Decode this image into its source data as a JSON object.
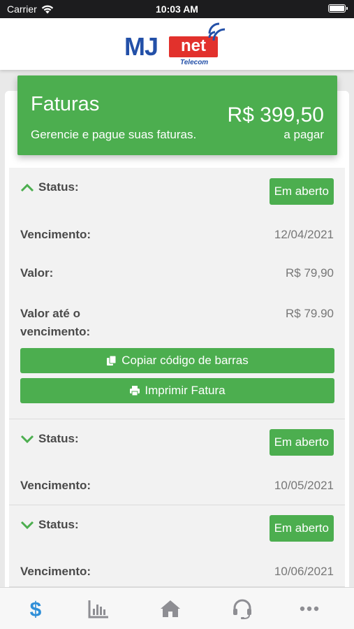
{
  "status_bar": {
    "carrier": "Carrier",
    "time": "10:03 AM"
  },
  "logo": {
    "mj": "MJ",
    "net": "net",
    "telecom": "Telecom"
  },
  "banner": {
    "title": "Faturas",
    "subtitle": "Gerencie e pague suas faturas.",
    "amount": "R$ 399,50",
    "amount_label": "a pagar"
  },
  "invoices": [
    {
      "status_label": "Status:",
      "status_value": "Em aberto",
      "expanded": true,
      "due_label": "Vencimento:",
      "due_value": "12/04/2021",
      "amount_label": "Valor:",
      "amount_value": "R$ 79,90",
      "amount_due_label_1": "Valor até o",
      "amount_due_label_2": "vencimento:",
      "amount_due_value": "R$ 79.90",
      "copy_button": "Copiar código de barras",
      "print_button": "Imprimir Fatura"
    },
    {
      "status_label": "Status:",
      "status_value": "Em aberto",
      "expanded": false,
      "due_label": "Vencimento:",
      "due_value": "10/05/2021"
    },
    {
      "status_label": "Status:",
      "status_value": "Em aberto",
      "expanded": false,
      "due_label": "Vencimento:",
      "due_value": "10/06/2021"
    }
  ],
  "tabs": [
    {
      "icon": "dollar-icon",
      "active": true
    },
    {
      "icon": "chart-icon",
      "active": false
    },
    {
      "icon": "home-icon",
      "active": false
    },
    {
      "icon": "headset-icon",
      "active": false
    },
    {
      "icon": "more-icon",
      "active": false
    }
  ],
  "colors": {
    "green": "#4cae4f",
    "active_tab": "#2f8fd8",
    "inactive_tab": "#8e8e93",
    "brand_blue": "#2350a8",
    "brand_red": "#e2312c"
  }
}
